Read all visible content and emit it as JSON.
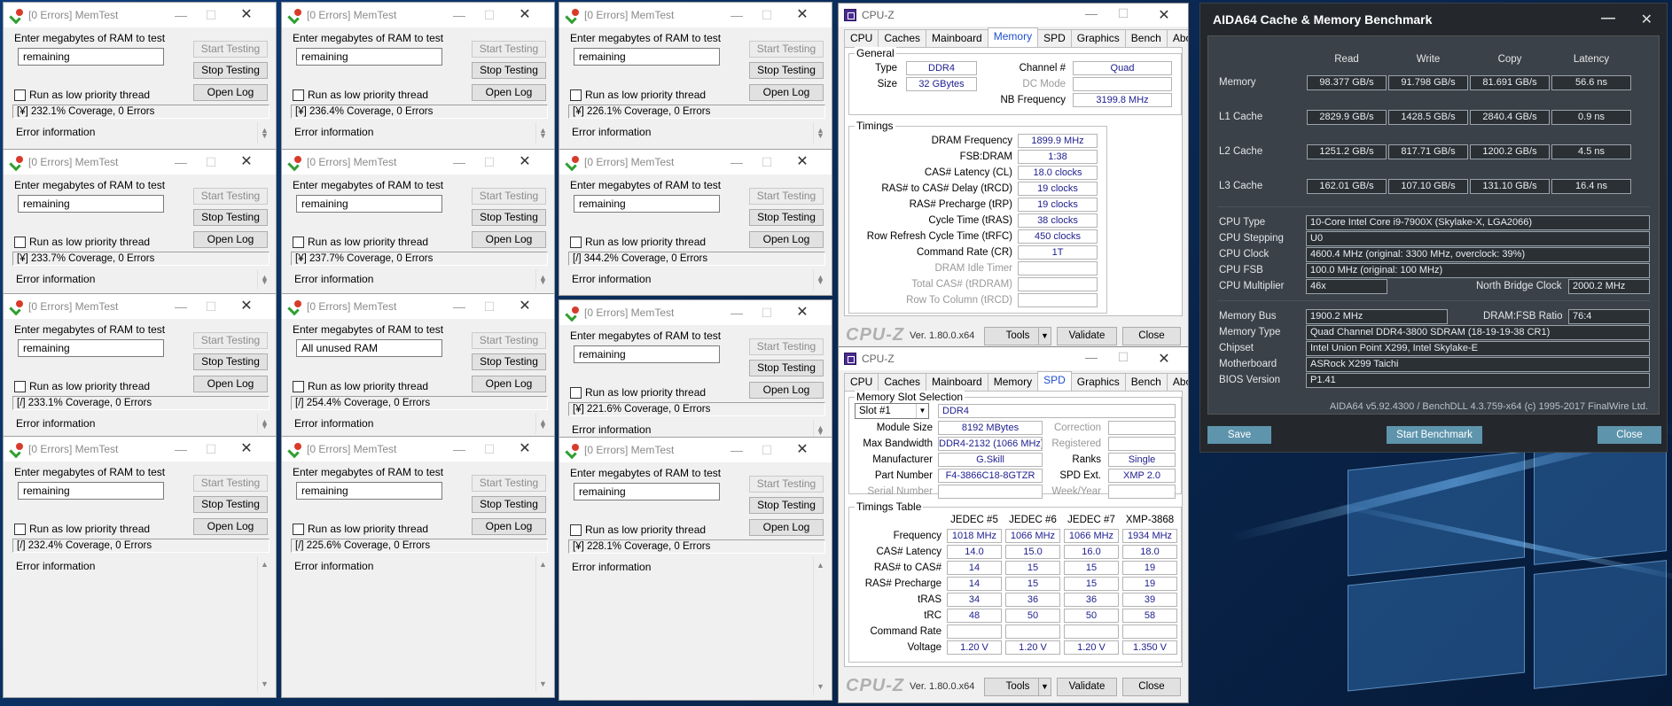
{
  "memtest": {
    "title": "[0 Errors] MemTest",
    "prompt": "Enter megabytes of RAM to test",
    "start_label": "Start Testing",
    "stop_label": "Stop Testing",
    "log_label": "Open Log",
    "low_priority_label": "Run as low priority thread",
    "error_info_label": "Error information",
    "windows": [
      {
        "field": "remaining",
        "status": "[¥]  232.1% Coverage, 0 Errors"
      },
      {
        "field": "remaining",
        "status": "[¥]  233.7% Coverage, 0 Errors"
      },
      {
        "field": "remaining",
        "status": "[/]  233.1% Coverage, 0 Errors"
      },
      {
        "field": "remaining",
        "status": "[/]  232.4% Coverage, 0 Errors"
      },
      {
        "field": "remaining",
        "status": "[¥]  236.4% Coverage, 0 Errors"
      },
      {
        "field": "remaining",
        "status": "[¥]  237.7% Coverage, 0 Errors"
      },
      {
        "field": "All unused RAM",
        "status": "[/]  254.4% Coverage, 0 Errors"
      },
      {
        "field": "remaining",
        "status": "[/]  225.6% Coverage, 0 Errors"
      },
      {
        "field": "remaining",
        "status": "[¥]  226.1% Coverage, 0 Errors"
      },
      {
        "field": "remaining",
        "status": "[/]  344.2% Coverage, 0 Errors"
      },
      {
        "field": "remaining",
        "status": "[¥]  221.6% Coverage, 0 Errors"
      },
      {
        "field": "remaining",
        "status": "[¥]  228.1% Coverage, 0 Errors"
      }
    ]
  },
  "cpuz": {
    "title": "CPU-Z",
    "tabs": [
      "CPU",
      "Caches",
      "Mainboard",
      "Memory",
      "SPD",
      "Graphics",
      "Bench",
      "About"
    ],
    "brand": "CPU-Z",
    "version": "Ver. 1.80.0.x64",
    "tools_label": "Tools",
    "validate_label": "Validate",
    "close_label": "Close",
    "memory": {
      "general_title": "General",
      "type_label": "Type",
      "type_value": "DDR4",
      "size_label": "Size",
      "size_value": "32 GBytes",
      "channel_label": "Channel #",
      "channel_value": "Quad",
      "dc_label": "DC Mode",
      "dc_value": "",
      "nb_label": "NB Frequency",
      "nb_value": "3199.8 MHz",
      "timings_title": "Timings",
      "timings": [
        {
          "label": "DRAM Frequency",
          "value": "1899.9 MHz",
          "dim": false
        },
        {
          "label": "FSB:DRAM",
          "value": "1:38",
          "dim": false
        },
        {
          "label": "CAS# Latency (CL)",
          "value": "18.0 clocks",
          "dim": false
        },
        {
          "label": "RAS# to CAS# Delay (tRCD)",
          "value": "19 clocks",
          "dim": false
        },
        {
          "label": "RAS# Precharge (tRP)",
          "value": "19 clocks",
          "dim": false
        },
        {
          "label": "Cycle Time (tRAS)",
          "value": "38 clocks",
          "dim": false
        },
        {
          "label": "Row Refresh Cycle Time (tRFC)",
          "value": "450 clocks",
          "dim": false
        },
        {
          "label": "Command Rate (CR)",
          "value": "1T",
          "dim": false
        },
        {
          "label": "DRAM Idle Timer",
          "value": "",
          "dim": true
        },
        {
          "label": "Total CAS# (tRDRAM)",
          "value": "",
          "dim": true
        },
        {
          "label": "Row To Column (tRCD)",
          "value": "",
          "dim": true
        }
      ]
    },
    "spd": {
      "slot_title": "Memory Slot Selection",
      "slot_value": "Slot #1",
      "type_value": "DDR4",
      "module_size_label": "Module Size",
      "module_size_value": "8192 MBytes",
      "max_bw_label": "Max Bandwidth",
      "max_bw_value": "DDR4-2132 (1066 MHz)",
      "mfr_label": "Manufacturer",
      "mfr_value": "G.Skill",
      "part_label": "Part Number",
      "part_value": "F4-3866C18-8GTZR",
      "serial_label": "Serial Number",
      "serial_value": "",
      "correction_label": "Correction",
      "correction_value": "",
      "registered_label": "Registered",
      "registered_value": "",
      "ranks_label": "Ranks",
      "ranks_value": "Single",
      "spdext_label": "SPD Ext.",
      "spdext_value": "XMP 2.0",
      "week_label": "Week/Year",
      "week_value": "",
      "table_title": "Timings Table",
      "columns": [
        "JEDEC #5",
        "JEDEC #6",
        "JEDEC #7",
        "XMP-3868"
      ],
      "rows": [
        {
          "label": "Frequency",
          "values": [
            "1018 MHz",
            "1066 MHz",
            "1066 MHz",
            "1934 MHz"
          ]
        },
        {
          "label": "CAS# Latency",
          "values": [
            "14.0",
            "15.0",
            "16.0",
            "18.0"
          ]
        },
        {
          "label": "RAS# to CAS#",
          "values": [
            "14",
            "15",
            "15",
            "19"
          ]
        },
        {
          "label": "RAS# Precharge",
          "values": [
            "14",
            "15",
            "15",
            "19"
          ]
        },
        {
          "label": "tRAS",
          "values": [
            "34",
            "36",
            "36",
            "39"
          ]
        },
        {
          "label": "tRC",
          "values": [
            "48",
            "50",
            "50",
            "58"
          ]
        },
        {
          "label": "Command Rate",
          "values": [
            "",
            "",
            "",
            ""
          ]
        },
        {
          "label": "Voltage",
          "values": [
            "1.20 V",
            "1.20 V",
            "1.20 V",
            "1.350 V"
          ]
        }
      ]
    }
  },
  "aida": {
    "title": "AIDA64 Cache & Memory Benchmark",
    "headers": [
      "Read",
      "Write",
      "Copy",
      "Latency"
    ],
    "bench_rows": [
      {
        "label": "Memory",
        "values": [
          "98.377 GB/s",
          "91.798 GB/s",
          "81.691 GB/s",
          "56.6 ns"
        ]
      },
      {
        "label": "L1 Cache",
        "values": [
          "2829.9 GB/s",
          "1428.5 GB/s",
          "2840.4 GB/s",
          "0.9 ns"
        ]
      },
      {
        "label": "L2 Cache",
        "values": [
          "1251.2 GB/s",
          "817.71 GB/s",
          "1200.2 GB/s",
          "4.5 ns"
        ]
      },
      {
        "label": "L3 Cache",
        "values": [
          "162.01 GB/s",
          "107.10 GB/s",
          "131.10 GB/s",
          "16.4 ns"
        ]
      }
    ],
    "cpu_type_label": "CPU Type",
    "cpu_type": "10-Core Intel Core i9-7900X  (Skylake-X, LGA2066)",
    "cpu_stepping_label": "CPU Stepping",
    "cpu_stepping": "U0",
    "cpu_clock_label": "CPU Clock",
    "cpu_clock": "4600.4 MHz  (original: 3300 MHz, overclock: 39%)",
    "cpu_fsb_label": "CPU FSB",
    "cpu_fsb": "100.0 MHz  (original: 100 MHz)",
    "cpu_mult_label": "CPU Multiplier",
    "cpu_mult": "46x",
    "nb_clock_label": "North Bridge Clock",
    "nb_clock": "2000.2 MHz",
    "mem_bus_label": "Memory Bus",
    "mem_bus": "1900.2 MHz",
    "dram_fsb_label": "DRAM:FSB Ratio",
    "dram_fsb": "76:4",
    "mem_type_label": "Memory Type",
    "mem_type": "Quad Channel DDR4-3800 SDRAM  (18-19-19-38 CR1)",
    "chipset_label": "Chipset",
    "chipset": "Intel Union Point X299, Intel Skylake-E",
    "mobo_label": "Motherboard",
    "mobo": "ASRock X299 Taichi",
    "bios_label": "BIOS Version",
    "bios": "P1.41",
    "footer": "AIDA64 v5.92.4300 / BenchDLL 4.3.759-x64  (c) 1995-2017 FinalWire Ltd.",
    "save_label": "Save",
    "start_label": "Start Benchmark",
    "close_label": "Close"
  }
}
